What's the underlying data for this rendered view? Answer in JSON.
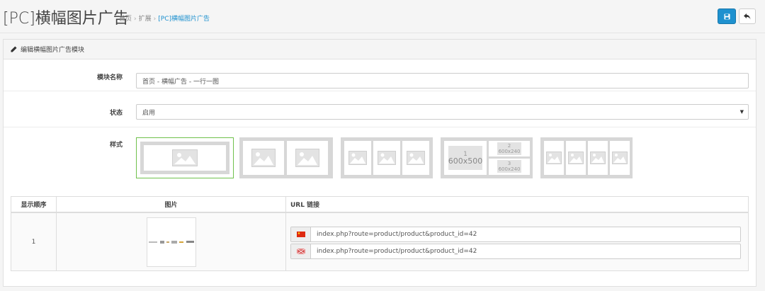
{
  "header": {
    "title": "[PC]横幅图片广告",
    "breadcrumb": [
      "首页",
      "扩展",
      "[PC]横幅图片广告"
    ],
    "breadcrumb_sep": "›"
  },
  "toolbar": {
    "save_icon": "save-icon",
    "back_icon": "reply-icon",
    "accent": "#1e91cf"
  },
  "panel": {
    "heading": "编辑横幅图片广告模块",
    "heading_icon": "pencil-icon"
  },
  "form": {
    "name_label": "模块名称",
    "name_value": "首页 - 横幅广告 - 一行一图",
    "status_label": "状态",
    "status_value": "启用",
    "style_label": "样式"
  },
  "styles": {
    "selected": 0,
    "style4_labels": {
      "big_num": "1",
      "big_size": "600x500",
      "top_num": "2",
      "top_size": "600x240",
      "bot_num": "3",
      "bot_size": "600x240"
    }
  },
  "table": {
    "headers": [
      "显示顺序",
      "图片",
      "URL 链接"
    ],
    "rows": [
      {
        "order": "1",
        "urls": [
          "index.php?route=product/product&product_id=42",
          "index.php?route=product/product&product_id=42"
        ]
      }
    ]
  }
}
